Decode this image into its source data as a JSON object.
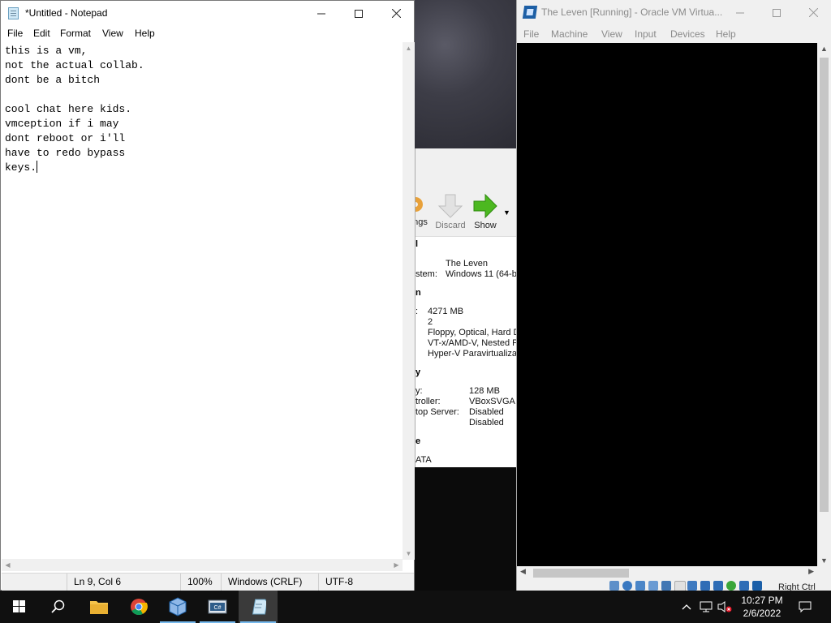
{
  "notepad": {
    "title": "*Untitled - Notepad",
    "menu": [
      "File",
      "Edit",
      "Format",
      "View",
      "Help"
    ],
    "content": "this is a vm,\nnot the actual collab.\ndont be a bitch\n\ncool chat here kids.\nvmception if i may\ndont reboot or i'll\nhave to redo bypass\nkeys.",
    "status": {
      "position": "Ln 9, Col 6",
      "zoom": "100%",
      "line_ending": "Windows (CRLF)",
      "encoding": "UTF-8"
    }
  },
  "vbox_manager": {
    "toolbar": {
      "settings_label": "ngs",
      "discard_label": "Discard",
      "show_label": "Show"
    },
    "sections": {
      "general": "l",
      "system": "n",
      "display": "y",
      "storage": "e"
    },
    "general": {
      "name_value": "The Leven",
      "os_label": "stem:",
      "os_value": "Windows 11 (64-b"
    },
    "system": {
      "memory_label": ":",
      "memory_value": "4271 MB",
      "cpus_value": "2",
      "boot_value": "Floppy, Optical, Hard D",
      "accel_value1": "VT-x/AMD-V, Nested P",
      "accel_value2": "Hyper-V Paravirtualizat"
    },
    "display": {
      "vram_label": "y:",
      "vram_value": "128 MB",
      "controller_label": "troller:",
      "controller_value": "VBoxSVGA",
      "rdp_label": "top Server:",
      "rdp_value": "Disabled",
      "recording_value": "Disabled"
    },
    "storage": {
      "controller": "ATA"
    }
  },
  "vm_window": {
    "title": "The Leven [Running] - Oracle VM Virtua...",
    "menu": [
      "File",
      "Machine",
      "View",
      "Input",
      "Devices",
      "Help"
    ],
    "host_key": "Right Ctrl"
  },
  "taskbar": {
    "time": "10:27 PM",
    "date": "2/6/2022"
  },
  "colors": {
    "taskbar": "#101010",
    "accent": "#76b9ed",
    "show_arrow": "#4cb820"
  }
}
